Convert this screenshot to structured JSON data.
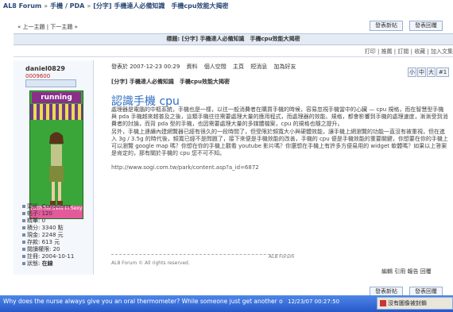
{
  "breadcrumb": [
    "AL8 Forum",
    "手機 / PDA",
    "[分字] 手機達人必備知識　手機cpu效能大揭密"
  ],
  "top_buttons": [
    "發表新帖",
    "發表回覆"
  ],
  "nav": {
    "prev": "« 上一主題",
    "next": "下一主題 »"
  },
  "thread_title": "標題: [分字] 手機達人必備知識　手機cpu效能大揭密",
  "tools": [
    "打印",
    "推薦",
    "訂閱",
    "收藏",
    "加入文集"
  ],
  "user": {
    "name": "daniel0829",
    "id": "0009600",
    "avatar_caption": "Faith hill Sells In Sexy",
    "avatar_logo": "running",
    "profile": [
      {
        "label": "頭銜",
        "value": "Conqueror"
      },
      {
        "label": "帖子",
        "value": "120"
      },
      {
        "label": "精華",
        "value": "0"
      },
      {
        "label": "積分",
        "value": "3340 點"
      },
      {
        "label": "現金",
        "value": "2248 元"
      },
      {
        "label": "存款",
        "value": "613 元"
      },
      {
        "label": "閱讀權限",
        "value": "20"
      },
      {
        "label": "註冊",
        "value": "2004-10-11"
      },
      {
        "label": "狀態",
        "value": "在線"
      }
    ]
  },
  "post": {
    "meta": [
      "發表於 2007-12-23 00:29",
      "資料",
      "個人空間",
      "主頁",
      "短消息",
      "加為好友"
    ],
    "page_ctl": [
      "小",
      "中",
      "大",
      "#1"
    ],
    "subject": "[分字] 手機達人必備知識　手機cpu效能大揭密",
    "heading": "認識手機 cpu",
    "body1": "處理器是電腦的中樞系統，手機也是一樣，以往一般消費者在購買手機的時候，容易忽視手機當中的心臟 — cpu 規格，而在智慧型手機與 pda 手機越來越普及之後，這類手機往往需要處理大量的應用程式，而處理器的效能、規格，都會影響到手機的處理速度，漸漸受到消費者的討論，而背 pda 型的手機，也因需要處理大量的多媒體檔案，cpu 的規格也隨之提升。",
    "body2": "另外，手機上連續內建網覽器已經有很久的一段時間了，但受限於頻寬大小與硬體效能，讓手機上網瀏覽的功能一直沒有被重視，但在進入 3g / 3.5g 的時代後，頻寬已經不是問題了，接下來便是手機效能的改善，手機的 cpu 便是手機效能的重要關鍵，你想要在你的手機上可以瀏覽 google map 嗎？你想在你的手機上觀看 youtube 影片嗎？你還想在手機上有許多方便易用的 widget 軟體嗎？如果以上答案是肯定的，那有關於手機的 cpu 您不可不知。",
    "link": "http://www.sogi.com.tw/park/content.asp?a_id=6872",
    "sig_brand": "AL8 Forum",
    "copyright": "AL8 Forum © All rights reserved.",
    "actions": [
      "編輯",
      "引用",
      "報告",
      "回覆"
    ]
  },
  "bottom_buttons": [
    "發表新帖",
    "發表回覆"
  ],
  "taskbar": {
    "ticker": "Why does the nurse always give you an oral thermometer? While someone just get another o",
    "time": "12/23/07  00:27:50",
    "tray": "沒有圖像被封鎖"
  },
  "colors": {
    "accent": "#2f6fc1",
    "titlebar": "#e4ebf5",
    "taskbar": "#2758c9"
  }
}
